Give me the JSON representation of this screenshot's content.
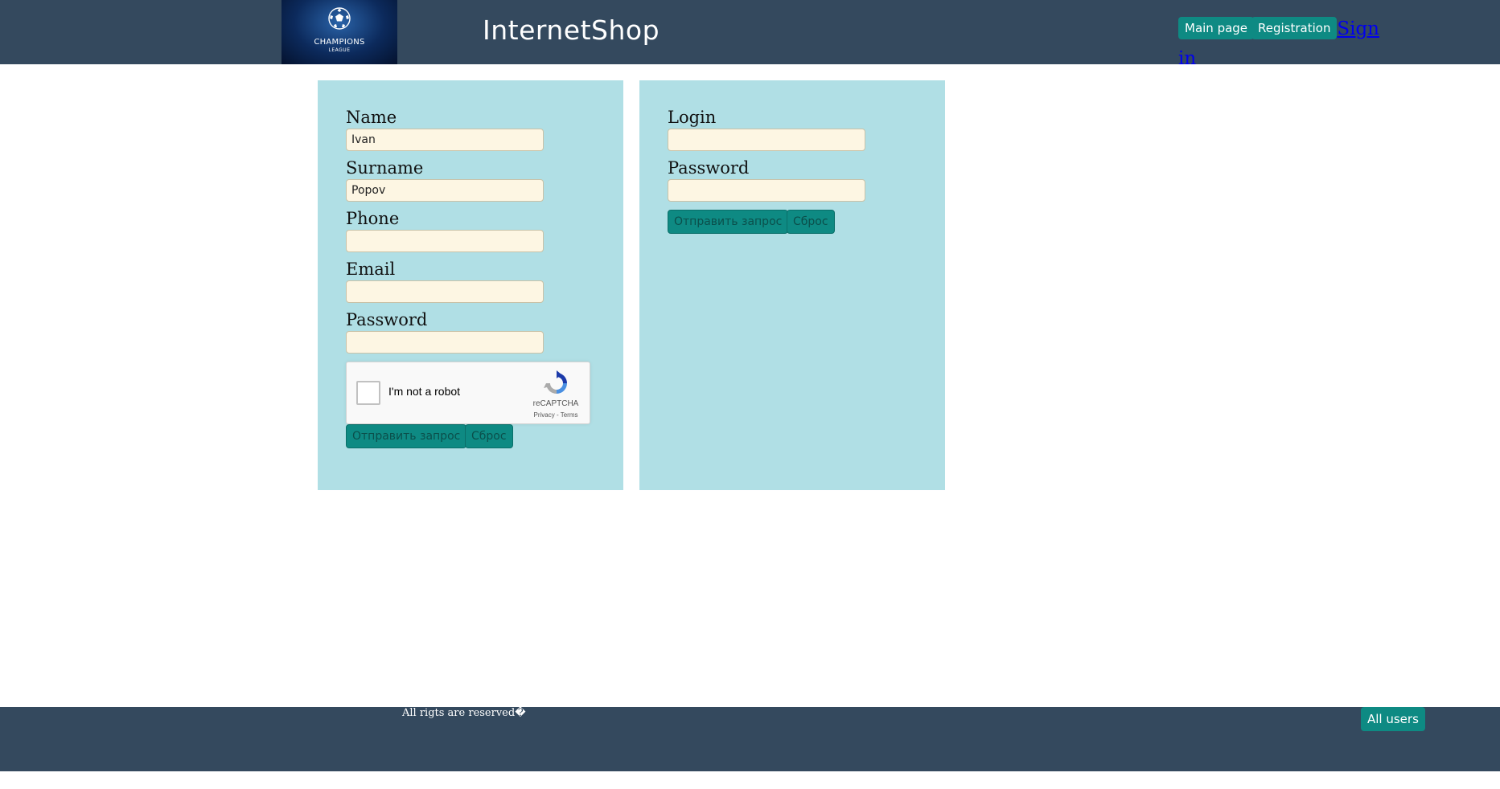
{
  "header": {
    "logo_line1": "CHAMPIONS",
    "logo_line2": "LEAGUE",
    "site_title": "InternetShop",
    "nav_main": "Main page",
    "nav_registration": "Registration",
    "signin_line1": "Sign",
    "signin_line2": "in"
  },
  "registration_form": {
    "name_label": "Name",
    "name_value": "Ivan",
    "surname_label": "Surname",
    "surname_value": "Popov",
    "phone_label": "Phone",
    "phone_value": "",
    "email_label": "Email",
    "email_value": "",
    "password_label": "Password",
    "password_value": "",
    "captcha_label": "I'm not a robot",
    "captcha_brand": "reCAPTCHA",
    "captcha_links": "Privacy - Terms",
    "submit_label": "Отправить запрос",
    "reset_label": "Сброс"
  },
  "login_form": {
    "login_label": "Login",
    "login_value": "",
    "password_label": "Password",
    "password_value": "",
    "submit_label": "Отправить запрос",
    "reset_label": "Сброс"
  },
  "footer": {
    "copyright": "All rigts are reserved�",
    "all_users": "All users"
  },
  "colors": {
    "header_bg": "#34495e",
    "panel_bg": "#b0dfe5",
    "button_bg": "#0e8a83",
    "input_bg": "#fdf6e3"
  },
  "icons": [
    "football-icon",
    "recaptcha-icon"
  ]
}
